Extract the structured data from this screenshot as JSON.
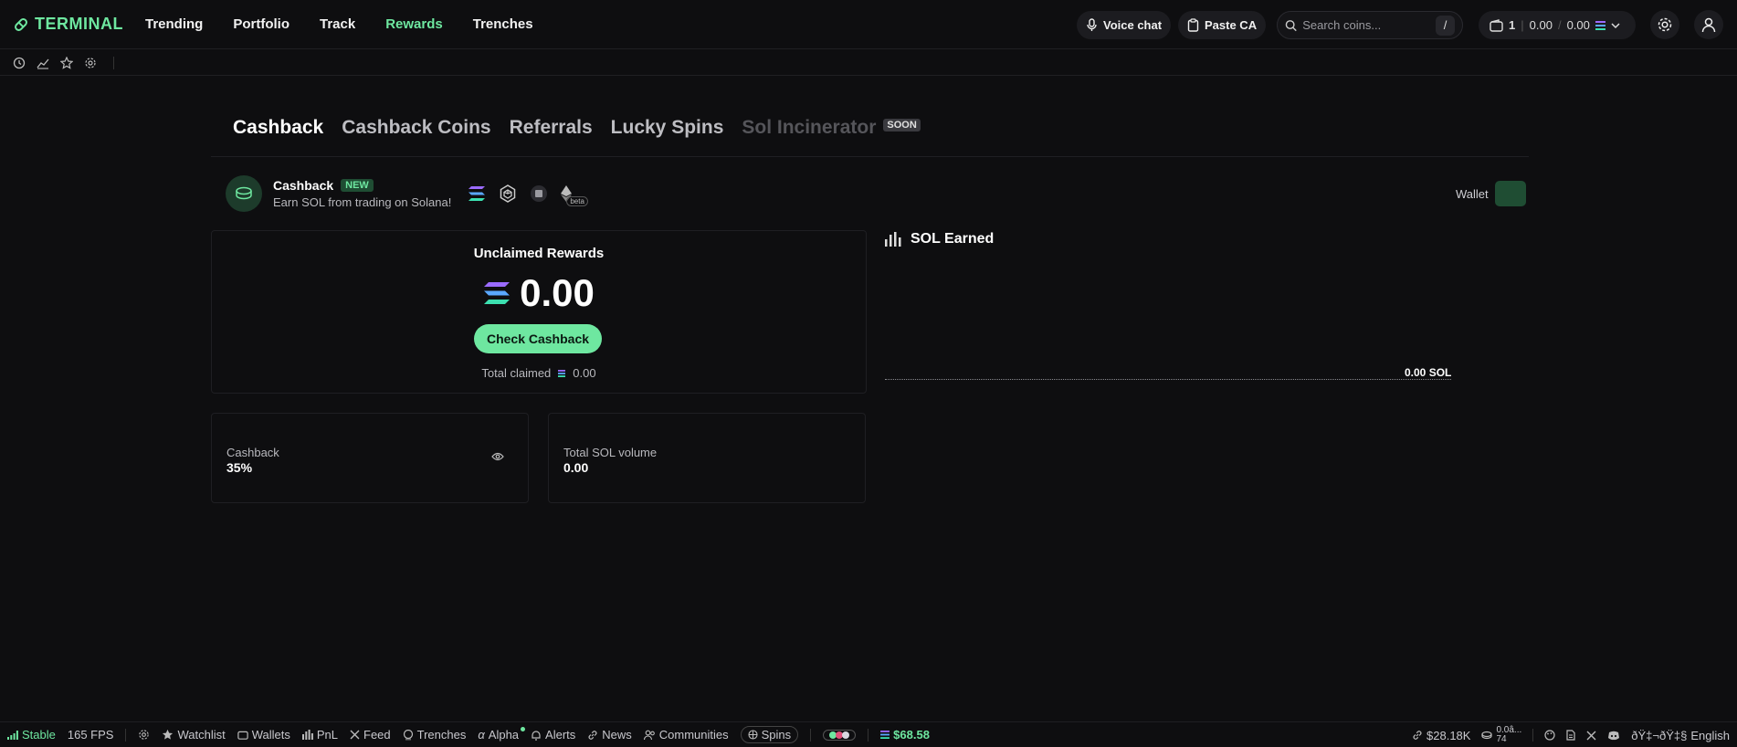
{
  "brand": {
    "name": "TERMINAL",
    "color": "#6ee7a0"
  },
  "nav": [
    {
      "label": "Trending",
      "active": false
    },
    {
      "label": "Portfolio",
      "active": false
    },
    {
      "label": "Track",
      "active": false
    },
    {
      "label": "Rewards",
      "active": true
    },
    {
      "label": "Trenches",
      "active": false
    }
  ],
  "header": {
    "voice_chat": "Voice chat",
    "paste_ca": "Paste CA",
    "search_placeholder": "Search coins...",
    "search_shortcut": "/",
    "wallet_count": "1",
    "balance_a": "0.00",
    "balance_sep": "/",
    "balance_b": "0.00"
  },
  "subbar_icons": [
    "history-icon",
    "chart-icon",
    "star-icon",
    "gear-icon"
  ],
  "tabs": [
    {
      "label": "Cashback",
      "state": "active"
    },
    {
      "label": "Cashback Coins",
      "state": "normal"
    },
    {
      "label": "Referrals",
      "state": "normal"
    },
    {
      "label": "Lucky Spins",
      "state": "normal"
    },
    {
      "label": "Sol Incinerator",
      "state": "disabled",
      "badge": "SOON"
    }
  ],
  "cashback": {
    "title": "Cashback",
    "badge": "NEW",
    "subtitle": "Earn SOL from trading on Solana!",
    "beta": "beta",
    "wallet_label": "Wallet"
  },
  "unclaimed": {
    "title": "Unclaimed Rewards",
    "amount": "0.00",
    "button": "Check Cashback",
    "total_label": "Total claimed",
    "total_value": "0.00"
  },
  "stats": {
    "cashback_label": "Cashback",
    "cashback_value": "35%",
    "volume_label": "Total SOL volume",
    "volume_value": "0.00"
  },
  "earned": {
    "title": "SOL Earned",
    "value": "0.00 SOL"
  },
  "footer": {
    "status": "Stable",
    "fps": "165 FPS",
    "items": [
      "Watchlist",
      "Wallets",
      "PnL",
      "Feed",
      "Trenches",
      "Alpha",
      "Alerts",
      "News",
      "Communities"
    ],
    "spins": "Spins",
    "sol_price": "$68.58",
    "right_a": "$28.18K",
    "right_b_top": "0.0â...",
    "right_b_bottom": "74",
    "lang_garbled": "ðŸ‡¬ðŸ‡§",
    "lang": "English"
  }
}
